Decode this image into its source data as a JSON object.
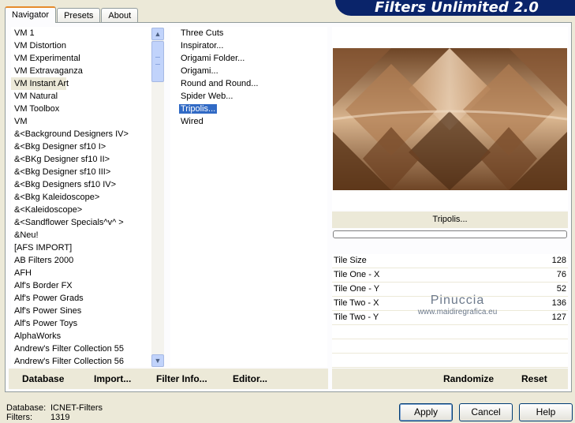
{
  "tabs": [
    "Navigator",
    "Presets",
    "About"
  ],
  "banner": "Filters Unlimited 2.0",
  "categories": [
    "VM 1",
    "VM Distortion",
    "VM Experimental",
    "VM Extravaganza",
    "VM Instant Art",
    "VM Natural",
    "VM Toolbox",
    "VM",
    "&<Background Designers IV>",
    "&<Bkg Designer sf10 I>",
    "&<BKg Designer sf10 II>",
    "&<Bkg Designer sf10 III>",
    "&<Bkg Designers sf10 IV>",
    "&<Bkg Kaleidoscope>",
    "&<Kaleidoscope>",
    "&<Sandflower Specials^v^ >",
    "&Neu!",
    "[AFS IMPORT]",
    "AB Filters 2000",
    "AFH",
    "Alf's Border FX",
    "Alf's Power Grads",
    "Alf's Power Sines",
    "Alf's Power Toys",
    "AlphaWorks",
    "Andrew's Filter Collection 55",
    "Andrew's Filter Collection 56"
  ],
  "filters": [
    "Three Cuts",
    "Inspirator...",
    "Origami Folder...",
    "Origami...",
    "Round and Round...",
    "Spider Web...",
    "Tripolis...",
    "Wired"
  ],
  "selected_filter": "Tripolis...",
  "filter_label": "Tripolis...",
  "params": [
    {
      "label": "Tile Size",
      "value": "128"
    },
    {
      "label": "Tile One - X",
      "value": "76"
    },
    {
      "label": "Tile One - Y",
      "value": "52"
    },
    {
      "label": "Tile Two - X",
      "value": "136"
    },
    {
      "label": "Tile Two - Y",
      "value": "127"
    }
  ],
  "watermark": {
    "line1": "Pinuccia",
    "line2": "www.maidiregrafica.eu"
  },
  "bottom_left": {
    "database": "Database",
    "import": "Import...",
    "filter_info": "Filter Info...",
    "editor": "Editor..."
  },
  "bottom_right": {
    "randomize": "Randomize",
    "reset": "Reset"
  },
  "status": {
    "db_label": "Database:",
    "db_value": "ICNET-Filters",
    "filters_label": "Filters:",
    "filters_value": "1319"
  },
  "buttons": {
    "apply": "Apply",
    "cancel": "Cancel",
    "help": "Help"
  },
  "colors": {
    "accent": "#316ac5",
    "banner": "#0a246a",
    "preview_dark": "#7a4e2a",
    "preview_light": "#d4a97e"
  }
}
